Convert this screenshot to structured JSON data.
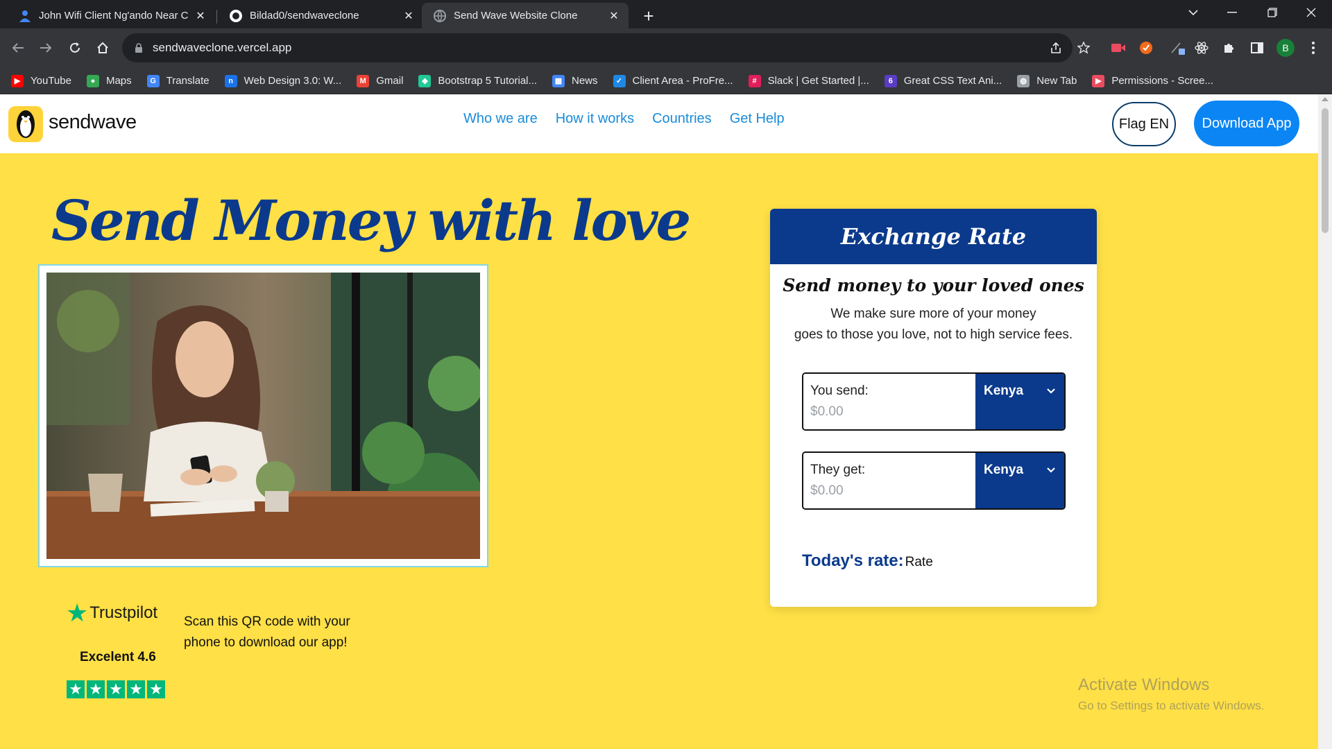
{
  "tabs": [
    {
      "title": "John Wifi Client Ng'ando Near C",
      "close": "✕"
    },
    {
      "title": "Bildad0/sendwaveclone",
      "close": "✕"
    },
    {
      "title": "Send Wave Website Clone",
      "close": "✕"
    }
  ],
  "new_tab": "+",
  "omnibox": {
    "url": "sendwaveclone.vercel.app"
  },
  "profile_initial": "B",
  "bookmarks": [
    {
      "label": "YouTube",
      "icon": "youtube-icon",
      "color": "#ff0000"
    },
    {
      "label": "Maps",
      "icon": "maps-icon",
      "color": "#34a853"
    },
    {
      "label": "Translate",
      "icon": "translate-icon",
      "color": "#4285f4"
    },
    {
      "label": "Web Design 3.0: W...",
      "icon": "notion-icon",
      "color": "#1a73e8"
    },
    {
      "label": "Gmail",
      "icon": "gmail-icon",
      "color": "#ea4335"
    },
    {
      "label": "Bootstrap 5 Tutorial...",
      "icon": "bootstrap-icon",
      "color": "#20c997"
    },
    {
      "label": "News",
      "icon": "news-icon",
      "color": "#4285f4"
    },
    {
      "label": "Client Area - ProFre...",
      "icon": "profreehost-icon",
      "color": "#1e88e5"
    },
    {
      "label": "Slack | Get Started |...",
      "icon": "slack-icon",
      "color": "#e01e5a"
    },
    {
      "label": "Great CSS Text Ani...",
      "icon": "css-six-icon",
      "color": "#5b3cc4"
    },
    {
      "label": "New Tab",
      "icon": "globe-icon",
      "color": "#9aa0a6"
    },
    {
      "label": "Permissions - Scree...",
      "icon": "screencast-icon",
      "color": "#ea4c5f"
    }
  ],
  "site": {
    "logo_text": "sendwave",
    "nav": [
      "Who we are",
      "How it works",
      "Countries",
      "Get Help"
    ],
    "flag_button": "Flag EN",
    "download_button": "Download App",
    "hero_title": "Send Money with love",
    "trustpilot": {
      "brand": "Trustpilot",
      "score": "Excelent 4.6",
      "rating": 5,
      "star_color": "#00b67a"
    },
    "qr_text": "Scan this QR code with your phone to download our app!",
    "card": {
      "title": "Exchange Rate",
      "subtitle": "Send money to your loved ones",
      "description_line1": "We make sure more of your money",
      "description_line2": "goes to those you love, not to high service fees.",
      "send_label": "You send:",
      "send_value": "$0.00",
      "send_country": "Kenya",
      "get_label": "They get:",
      "get_value": "$0.00",
      "get_country": "Kenya",
      "rate_label": "Today's rate:",
      "rate_value": "Rate"
    }
  },
  "watermark": {
    "line1": "Activate Windows",
    "line2": "Go to Settings to activate Windows."
  },
  "colors": {
    "page_bg": "#ffe046",
    "brand_navy": "#0b3a8c",
    "nav_link": "#1a8bd8",
    "download_btn": "#0b85f3"
  }
}
